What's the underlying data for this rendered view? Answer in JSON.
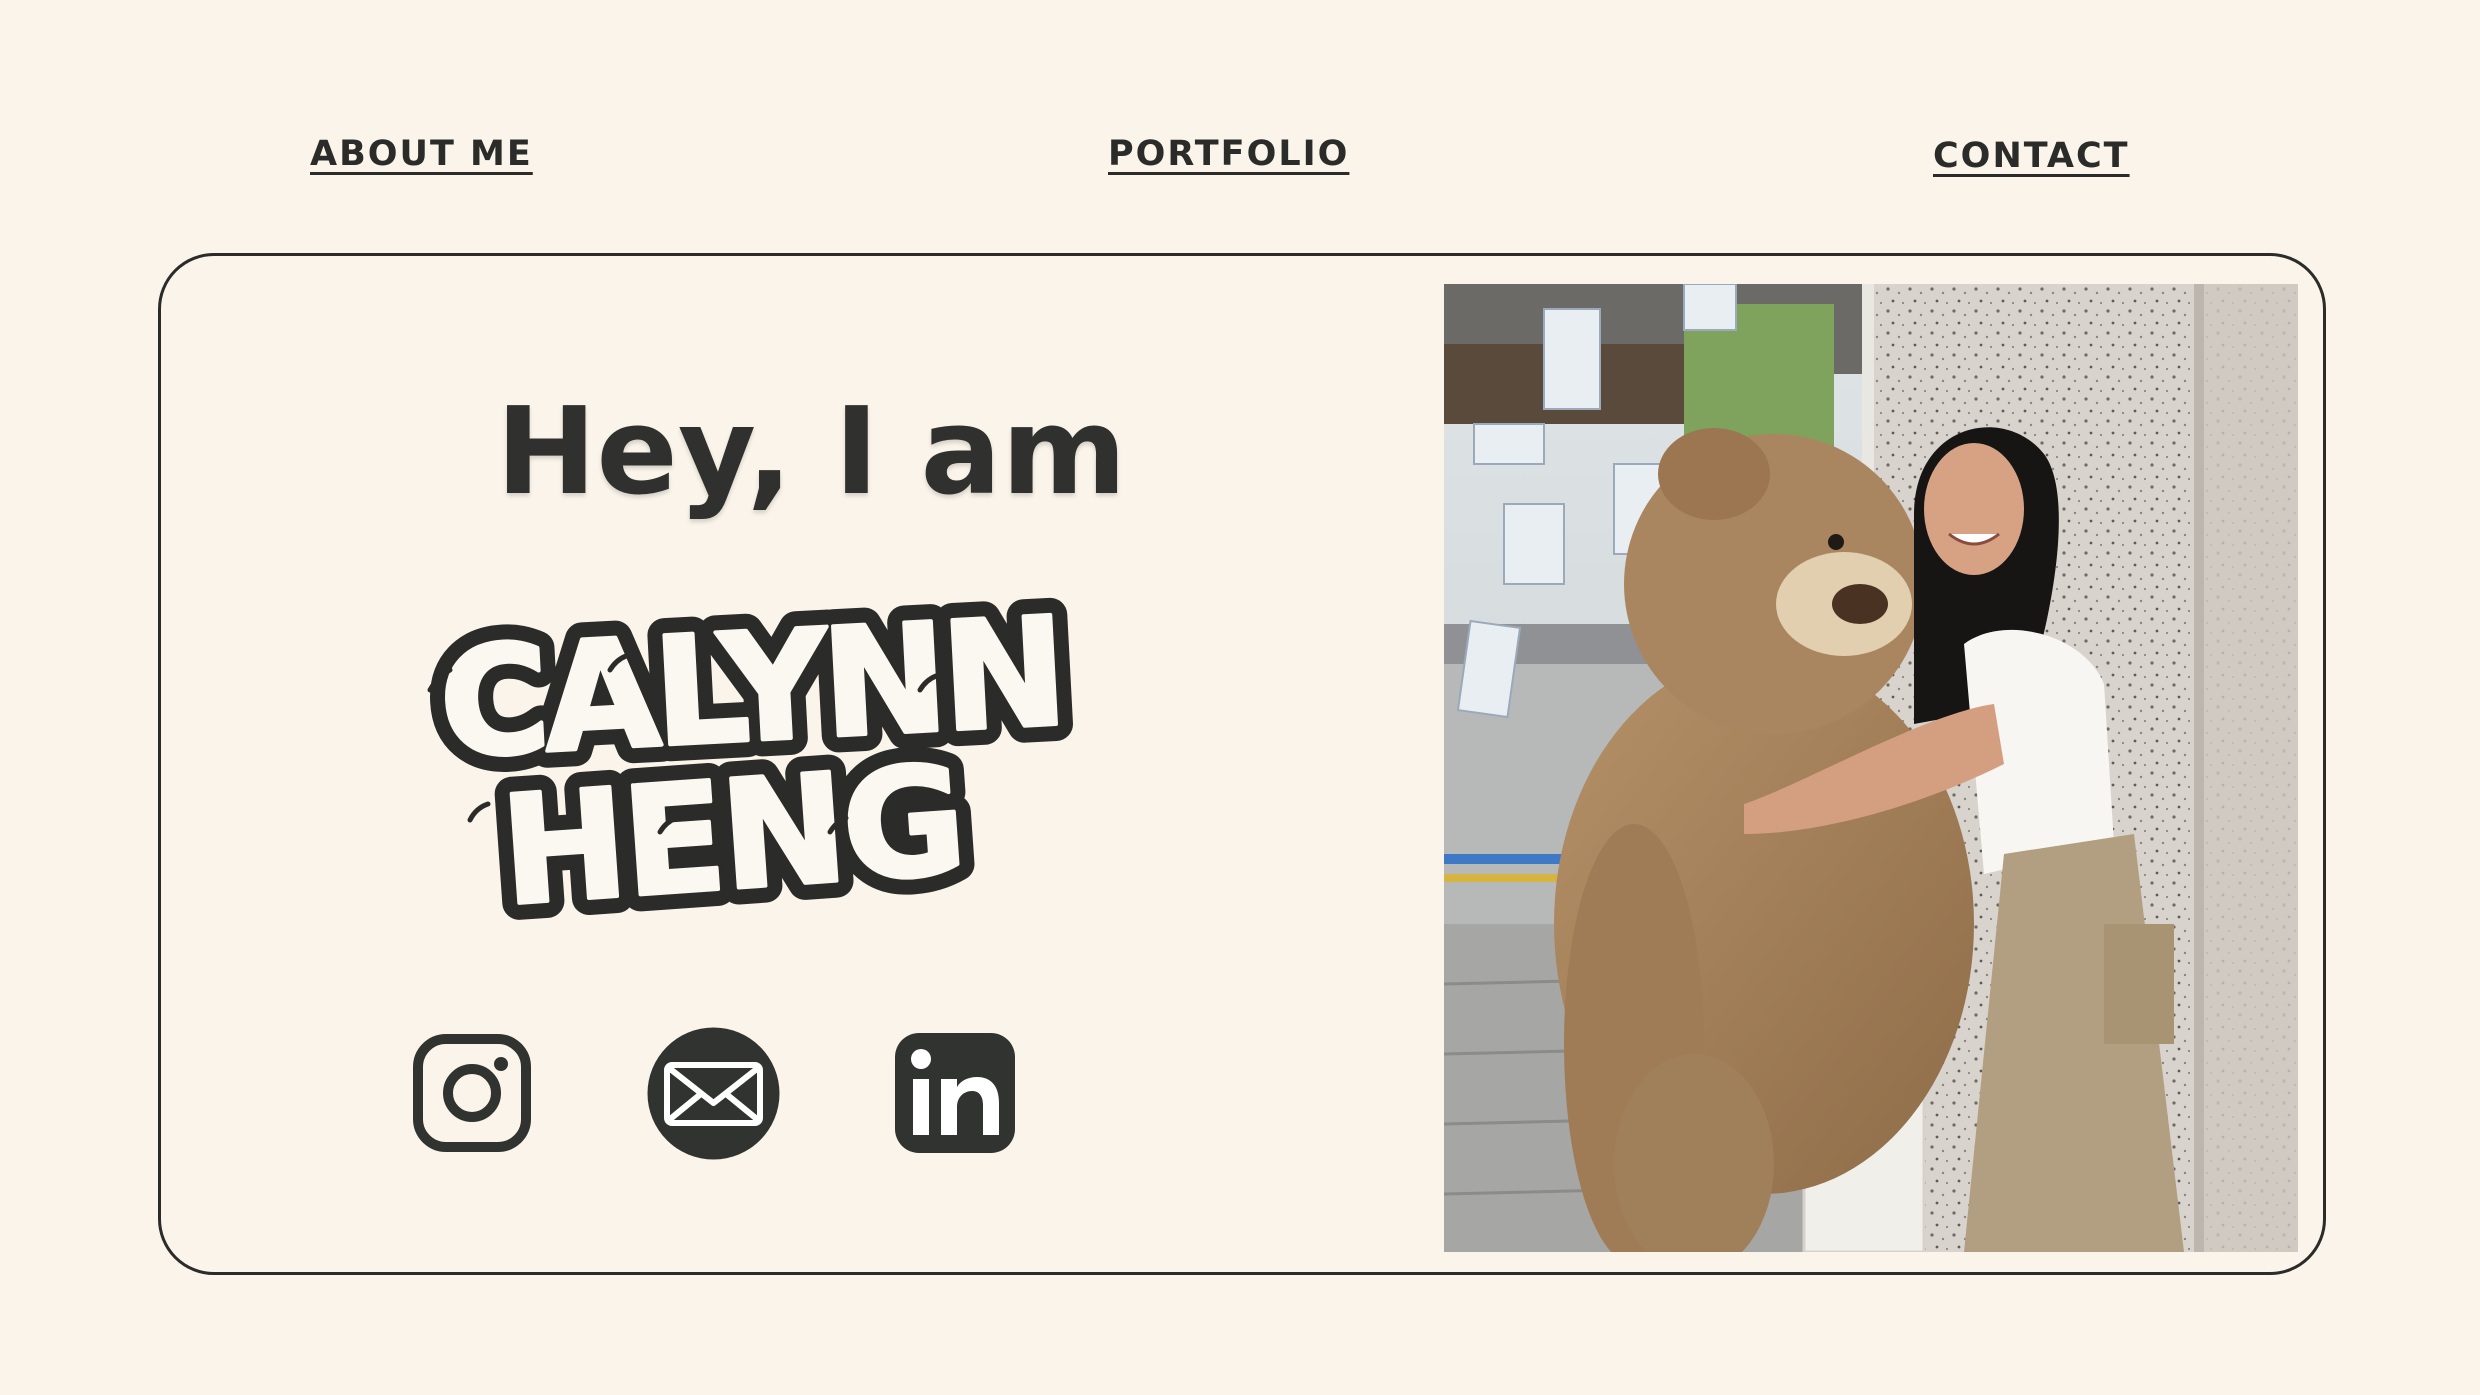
{
  "nav": {
    "about": "ABOUT ME",
    "portfolio": "PORTFOLIO",
    "contact": "CONTACT"
  },
  "hero": {
    "greeting": "Hey, I am",
    "first_name": "CALYNN",
    "last_name": "HENG"
  },
  "social": [
    {
      "name": "instagram-icon",
      "label": "Instagram"
    },
    {
      "name": "email-icon",
      "label": "Email"
    },
    {
      "name": "linkedin-icon",
      "label": "LinkedIn"
    }
  ],
  "colors": {
    "background": "#faf4ea",
    "ink": "#2b2b29",
    "icon": "#30332f"
  },
  "photo": {
    "subject": "photo-of-woman-hugging-giant-teddy-bear"
  }
}
